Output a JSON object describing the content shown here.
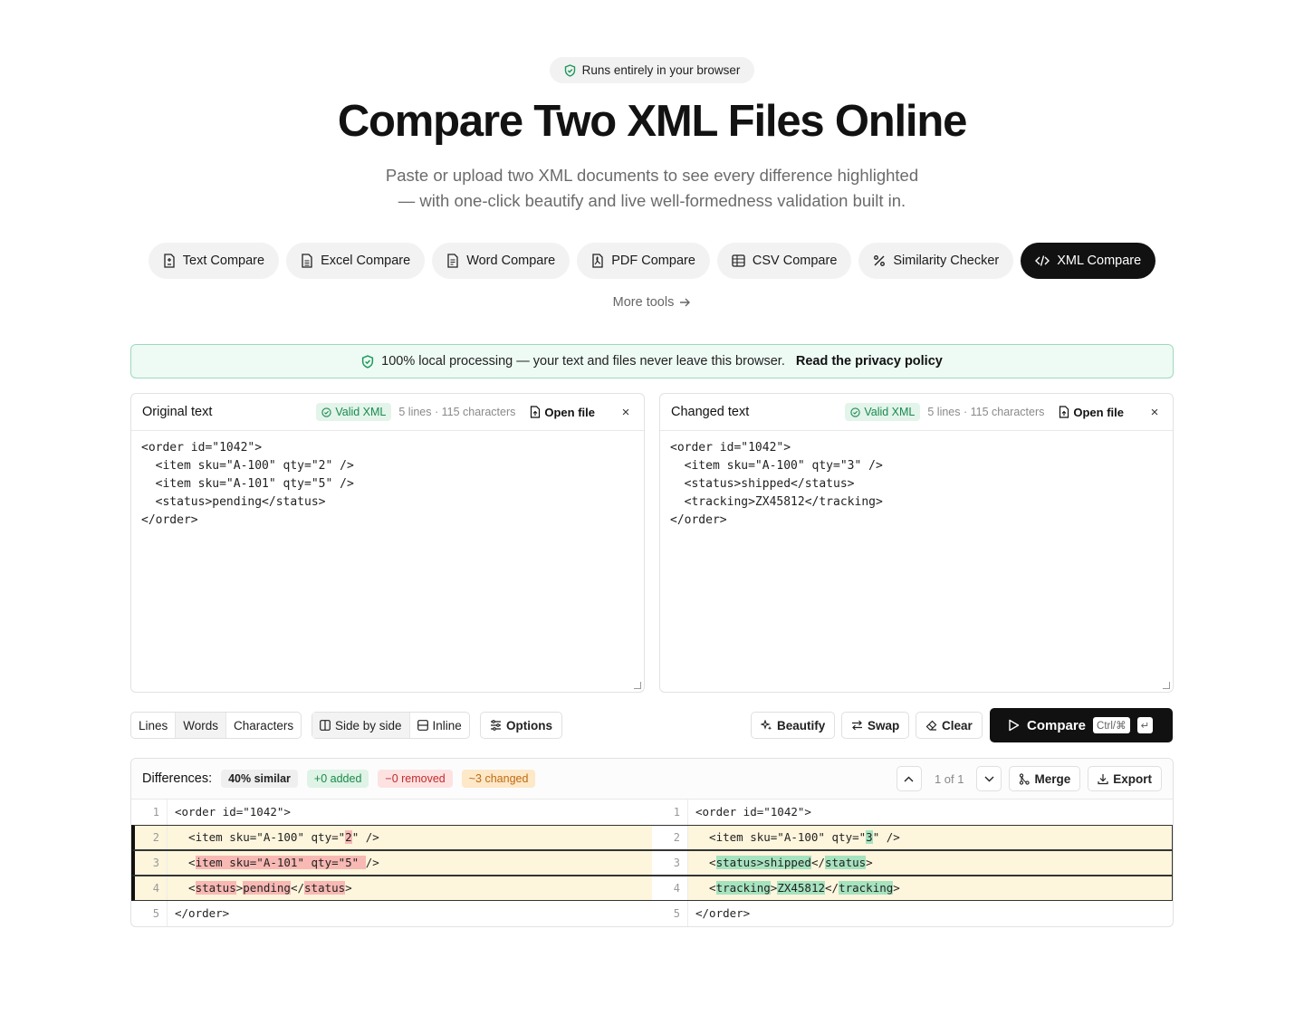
{
  "badge": {
    "icon": "shield-check-icon",
    "text": "Runs entirely in your browser"
  },
  "hero": {
    "title": "Compare Two XML Files Online",
    "subtitle_line1": "Paste or upload two XML documents to see every difference highlighted",
    "subtitle_line2": "— with one-click beautify and live well-formedness validation built in."
  },
  "tools": [
    {
      "label": "Text Compare",
      "icon": "file-text-icon"
    },
    {
      "label": "Excel Compare",
      "icon": "file-spreadsheet-icon"
    },
    {
      "label": "Word Compare",
      "icon": "file-doc-icon"
    },
    {
      "label": "PDF Compare",
      "icon": "file-pdf-icon"
    },
    {
      "label": "CSV Compare",
      "icon": "table-icon"
    },
    {
      "label": "Similarity Checker",
      "icon": "percent-icon"
    },
    {
      "label": "XML Compare",
      "icon": "code-icon",
      "active": true
    }
  ],
  "more_tools": "More tools",
  "privacy": {
    "text": "100% local processing — your text and files never leave this browser.",
    "link": "Read the privacy policy"
  },
  "original": {
    "title": "Original text",
    "valid": "Valid XML",
    "meta": "5 lines · 115 characters",
    "open": "Open file",
    "close": "×",
    "content": "<order id=\"1042\">\n  <item sku=\"A-100\" qty=\"2\" />\n  <item sku=\"A-101\" qty=\"5\" />\n  <status>pending</status>\n</order>"
  },
  "changed": {
    "title": "Changed text",
    "valid": "Valid XML",
    "meta": "5 lines · 115 characters",
    "open": "Open file",
    "close": "×",
    "content": "<order id=\"1042\">\n  <item sku=\"A-100\" qty=\"3\" />\n  <status>shipped</status>\n  <tracking>ZX45812</tracking>\n</order>"
  },
  "toolbar": {
    "granularity": [
      "Lines",
      "Words",
      "Characters"
    ],
    "view": [
      "Side by side",
      "Inline"
    ],
    "options": "Options",
    "beautify": "Beautify",
    "swap": "Swap",
    "clear": "Clear",
    "compare": "Compare",
    "shortcut": "Ctrl/⌘",
    "enter": "↵"
  },
  "differences": {
    "label": "Differences:",
    "similar": "40% similar",
    "added": "+0 added",
    "removed": "−0 removed",
    "changed": "~3 changed",
    "counter": "1 of 1",
    "merge": "Merge",
    "export": "Export"
  },
  "diff_rows": [
    {
      "n": "1",
      "left": "<order id=\"1042\">",
      "right": "<order id=\"1042\">"
    },
    {
      "n": "2",
      "left": "  <item sku=\"A-100\" qty=\"2\" />",
      "right": "  <item sku=\"A-100\" qty=\"3\" />"
    },
    {
      "n": "3",
      "left": "  <item sku=\"A-101\" qty=\"5\" />",
      "right": "  <status>shipped</status>"
    },
    {
      "n": "4",
      "left": "  <status>pending</status>",
      "right": "  <tracking>ZX45812</tracking>"
    },
    {
      "n": "5",
      "left": "</order>",
      "right": "</order>"
    }
  ],
  "colors": {
    "accent": "#111111",
    "valid": "#1b8a4e",
    "deleted": "#f8b8b3",
    "inserted": "#a6e3bf",
    "changed_row": "#fdf5dc"
  }
}
